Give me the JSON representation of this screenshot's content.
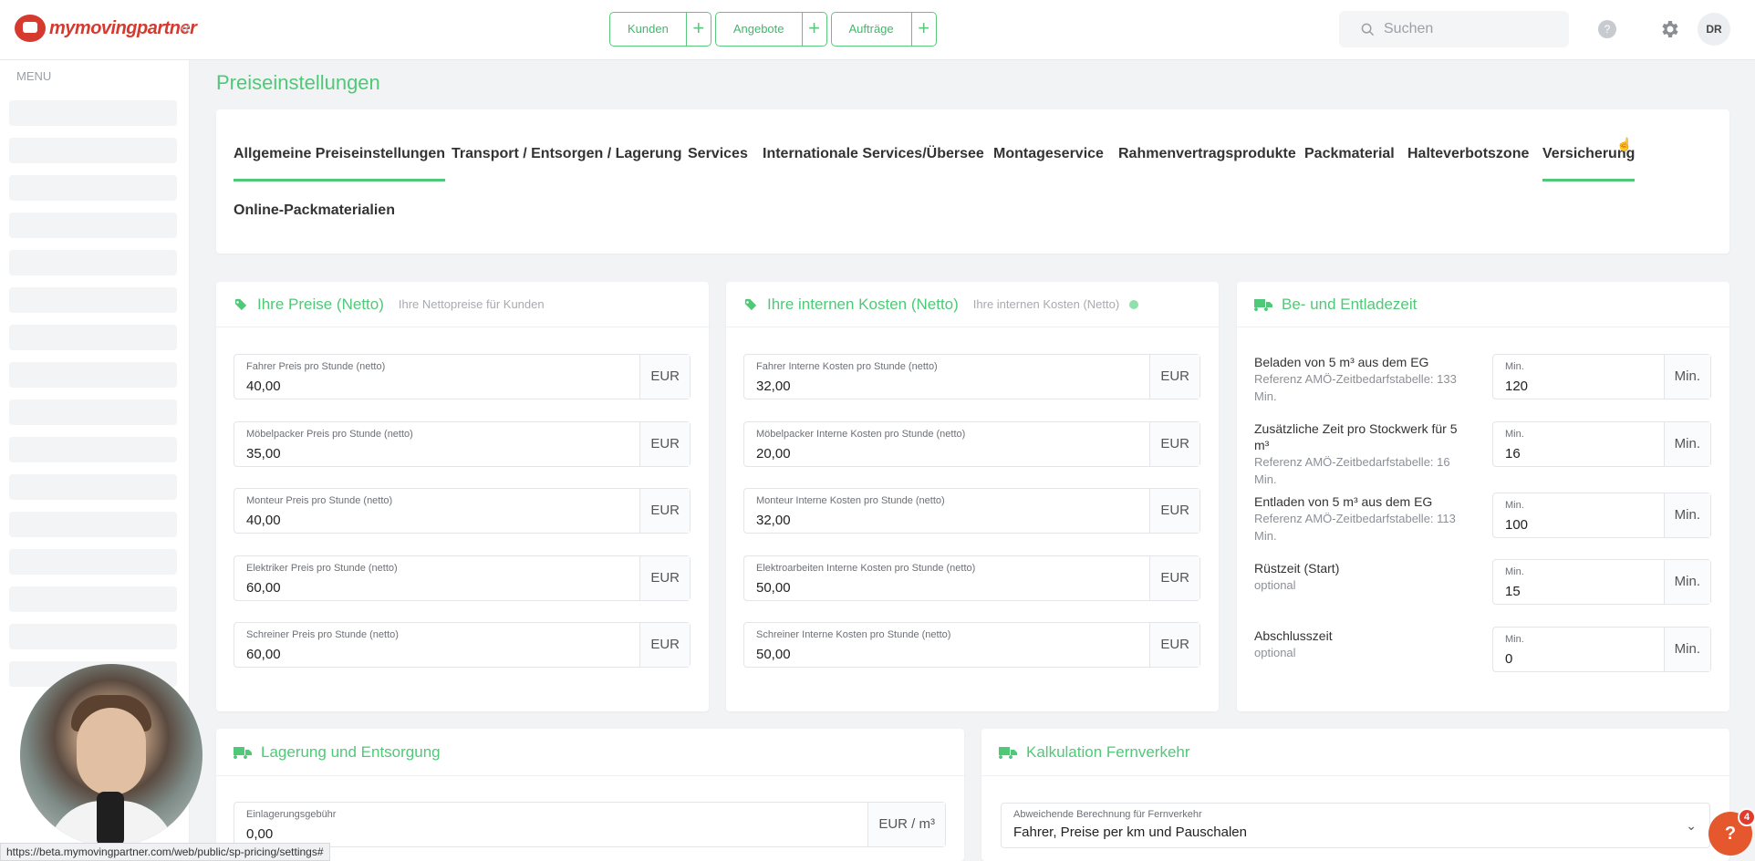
{
  "app": {
    "brand": "mymovingpartner"
  },
  "topnav": [
    {
      "label": "Kunden"
    },
    {
      "label": "Angebote"
    },
    {
      "label": "Aufträge"
    }
  ],
  "search": {
    "placeholder": "Suchen"
  },
  "help": {
    "label": "?"
  },
  "user": {
    "initials": "DR"
  },
  "sidebar": {
    "menu_label": "MENU"
  },
  "page": {
    "title": "Preiseinstellungen"
  },
  "tabs": [
    {
      "label": "Allgemeine Preiseinstellungen",
      "active": true
    },
    {
      "label": "Transport / Entsorgen / Lagerung"
    },
    {
      "label": "Services"
    },
    {
      "label": "Internationale Services/Übersee"
    },
    {
      "label": "Montageservice"
    },
    {
      "label": "Rahmenvertragsprodukte"
    },
    {
      "label": "Packmaterial"
    },
    {
      "label": "Halteverbotszone"
    },
    {
      "label": "Versicherung",
      "hovered": true
    },
    {
      "label": "Online-Packmaterialien"
    }
  ],
  "prices": {
    "title": "Ihre Preise (Netto)",
    "subtitle": "Ihre Nettopreise für Kunden",
    "fields": [
      {
        "label": "Fahrer Preis pro Stunde (netto)",
        "value": "40,00",
        "unit": "EUR"
      },
      {
        "label": "Möbelpacker Preis pro Stunde (netto)",
        "value": "35,00",
        "unit": "EUR"
      },
      {
        "label": "Monteur Preis pro Stunde (netto)",
        "value": "40,00",
        "unit": "EUR"
      },
      {
        "label": "Elektriker Preis pro Stunde (netto)",
        "value": "60,00",
        "unit": "EUR"
      },
      {
        "label": "Schreiner Preis pro Stunde (netto)",
        "value": "60,00",
        "unit": "EUR"
      }
    ]
  },
  "costs": {
    "title": "Ihre internen Kosten (Netto)",
    "subtitle": "Ihre internen Kosten (Netto)",
    "fields": [
      {
        "label": "Fahrer Interne Kosten pro Stunde (netto)",
        "value": "32,00",
        "unit": "EUR"
      },
      {
        "label": "Möbelpacker Interne Kosten pro Stunde (netto)",
        "value": "20,00",
        "unit": "EUR"
      },
      {
        "label": "Monteur Interne Kosten pro Stunde (netto)",
        "value": "32,00",
        "unit": "EUR"
      },
      {
        "label": "Elektroarbeiten Interne Kosten pro Stunde (netto)",
        "value": "50,00",
        "unit": "EUR"
      },
      {
        "label": "Schreiner Interne Kosten pro Stunde (netto)",
        "value": "50,00",
        "unit": "EUR"
      }
    ]
  },
  "loading": {
    "title": "Be- und Entladezeit",
    "rows": [
      {
        "label": "Beladen von 5 m³ aus dem EG",
        "sub": "Referenz AMÖ-Zeitbedarfstabelle: 133 Min.",
        "field_label": "Min.",
        "value": "120",
        "unit": "Min."
      },
      {
        "label": "Zusätzliche Zeit pro Stockwerk für 5 m³",
        "sub": "Referenz AMÖ-Zeitbedarfstabelle: 16 Min.",
        "field_label": "Min.",
        "value": "16",
        "unit": "Min."
      },
      {
        "label": "Entladen von 5 m³ aus dem EG",
        "sub": "Referenz AMÖ-Zeitbedarfstabelle: 113 Min.",
        "field_label": "Min.",
        "value": "100",
        "unit": "Min."
      },
      {
        "label": "Rüstzeit (Start)",
        "sub": "optional",
        "field_label": "Min.",
        "value": "15",
        "unit": "Min."
      },
      {
        "label": "Abschlusszeit",
        "sub": "optional",
        "field_label": "Min.",
        "value": "0",
        "unit": "Min."
      }
    ]
  },
  "storage": {
    "title": "Lagerung und Entsorgung",
    "fields": [
      {
        "label": "Einlagerungsgebühr",
        "value": "0,00",
        "unit": "EUR / m³"
      }
    ]
  },
  "longdistance": {
    "title": "Kalkulation Fernverkehr",
    "select_label": "Abweichende Berechnung für Fernverkehr",
    "select_value": "Fahrer, Preise per km und Pauschalen"
  },
  "status_url": "https://beta.mymovingpartner.com/web/public/sp-pricing/settings#",
  "chat": {
    "icon": "?",
    "badge": "4"
  },
  "colors": {
    "accent": "#4fc978",
    "brand": "#d63a2f",
    "chat": "#e5582e"
  }
}
